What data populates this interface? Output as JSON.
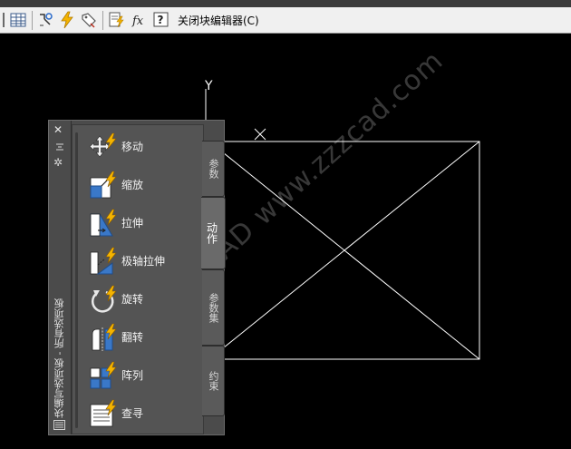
{
  "toolbar": {
    "close_editor_label": "关闭块编辑器(C)",
    "icons": [
      "grip-icon",
      "table-icon",
      "rebuild-icon",
      "lightning-icon",
      "tag-icon",
      "test-block-icon",
      "function-icon",
      "help-icon"
    ]
  },
  "canvas": {
    "axis_y_label": "Y",
    "watermark": "同站长CAD  www.zzzcad.com",
    "colors": {
      "background": "#000000",
      "lines": "#ffffff"
    }
  },
  "palette": {
    "title": "块编写选项板 - 所有选项板",
    "tools": [
      {
        "label": "移动",
        "icon": "move-action-icon"
      },
      {
        "label": "缩放",
        "icon": "scale-action-icon"
      },
      {
        "label": "拉伸",
        "icon": "stretch-action-icon"
      },
      {
        "label": "极轴拉伸",
        "icon": "polar-stretch-action-icon"
      },
      {
        "label": "旋转",
        "icon": "rotate-action-icon"
      },
      {
        "label": "翻转",
        "icon": "flip-action-icon"
      },
      {
        "label": "阵列",
        "icon": "array-action-icon"
      },
      {
        "label": "查寻",
        "icon": "lookup-action-icon"
      }
    ],
    "tabs": [
      {
        "label": "参数",
        "active": false
      },
      {
        "label": "动作",
        "active": true
      },
      {
        "label": "参数集",
        "active": false
      },
      {
        "label": "约束",
        "active": false
      }
    ],
    "colors": {
      "panel": "#4b4b4b",
      "text": "#f2f2f2",
      "lightning": "#f4b400"
    }
  }
}
